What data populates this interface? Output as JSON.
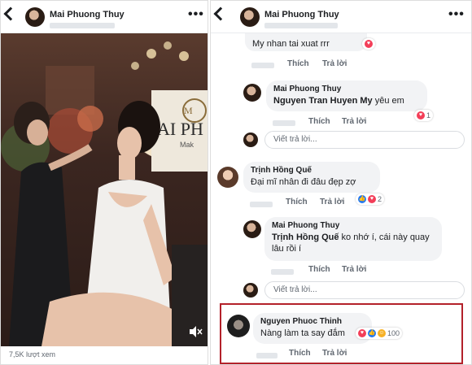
{
  "left": {
    "header": {
      "name": "Mai Phuong Thuy"
    },
    "video": {
      "views": "7,5K lượt xem",
      "mute_icon": "speaker-muted-icon",
      "salon_sign": "AI PH",
      "salon_sub": "Mak"
    }
  },
  "right": {
    "header": {
      "name": "Mai Phuong Thuy"
    },
    "comments": [
      {
        "text": "My nhan tai xuat rrr",
        "like": "Thích",
        "reply": "Trả lời"
      },
      {
        "name": "Mai Phuong Thuy",
        "tag": "Nguyen Tran Huyen My",
        "text": " yêu em",
        "like": "Thích",
        "reply": "Trả lời",
        "reaction_count": "1"
      },
      {
        "reply_placeholder": "Viết trả lời..."
      },
      {
        "name": "Trịnh Hồng Quế",
        "text": "Đại mĩ nhân đi đâu đẹp zợ",
        "like": "Thích",
        "reply": "Trả lời",
        "reaction_count": "2"
      },
      {
        "name": "Mai Phuong Thuy",
        "tag": "Trịnh Hồng Quế",
        "text": " ko nhớ í, cái này quay lâu rồi í",
        "like": "Thích",
        "reply": "Trả lời"
      },
      {
        "reply_placeholder": "Viết trả lời..."
      },
      {
        "name": "Nguyen Phuoc Thinh",
        "text": "Nàng làm ta say đắm",
        "like": "Thích",
        "reply": "Trả lời",
        "reaction_count": "100"
      }
    ]
  },
  "colors": {
    "link": "#385898",
    "highlight": "#b3212a",
    "bubble": "#f2f3f5"
  }
}
